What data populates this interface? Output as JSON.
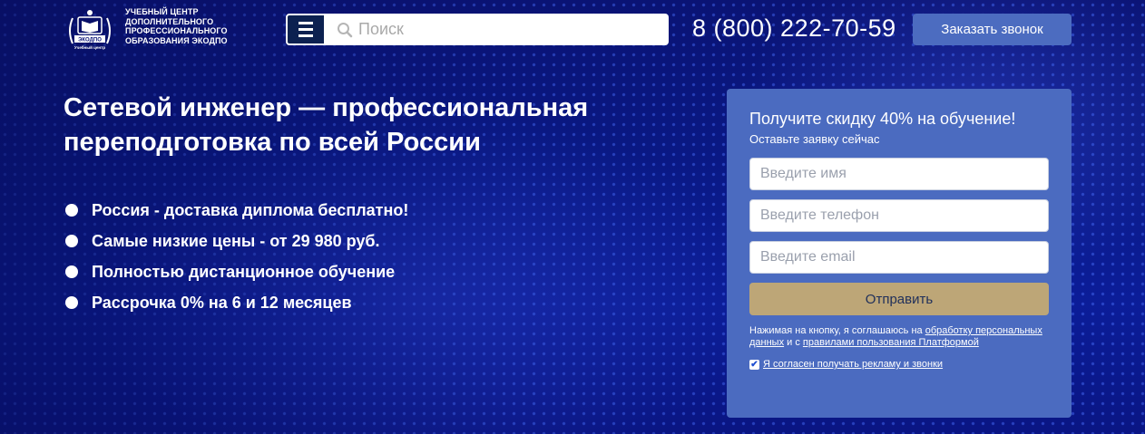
{
  "header": {
    "logo": {
      "lines": [
        "Учебный центр",
        "дополнительного",
        "профессионального",
        "образования ЭКОДПО"
      ],
      "emblem_text": "ЭКОДПО",
      "emblem_caption": "Учебный центр"
    },
    "search": {
      "placeholder": "Поиск"
    },
    "phone": "8 (800) 222-70-59",
    "callback_label": "Заказать звонок"
  },
  "hero": {
    "title": "Сетевой инженер — профессиональная переподготовка по всей России",
    "benefits": [
      "Россия - доставка диплома бесплатно!",
      "Самые низкие цены - от 29 980 руб.",
      "Полностью дистанционное обучение",
      "Рассрочка 0% на 6 и 12 месяцев"
    ]
  },
  "form": {
    "title": "Получите скидку 40% на обучение!",
    "subtitle": "Оставьте заявку сейчас",
    "name_placeholder": "Введите имя",
    "phone_placeholder": "Введите телефон",
    "email_placeholder": "Введите email",
    "submit_label": "Отправить",
    "consent": {
      "prefix": "Нажимая на кнопку, я соглашаюсь на ",
      "link1": "обработку персональных данных",
      "middle": " и с ",
      "link2": "правилами пользования Платформой"
    },
    "ads_checkbox_label": "Я согласен получать рекламу и звонки",
    "ads_checked": true
  },
  "colors": {
    "background": "#0a1a8a",
    "form_card": "#4b6bc0",
    "submit": "#bda677",
    "callback": "#4c6cc0",
    "menu": "#0c2150"
  },
  "icons": [
    "menu-icon",
    "search-icon",
    "logo-emblem-icon",
    "checkbox-checked-icon"
  ]
}
